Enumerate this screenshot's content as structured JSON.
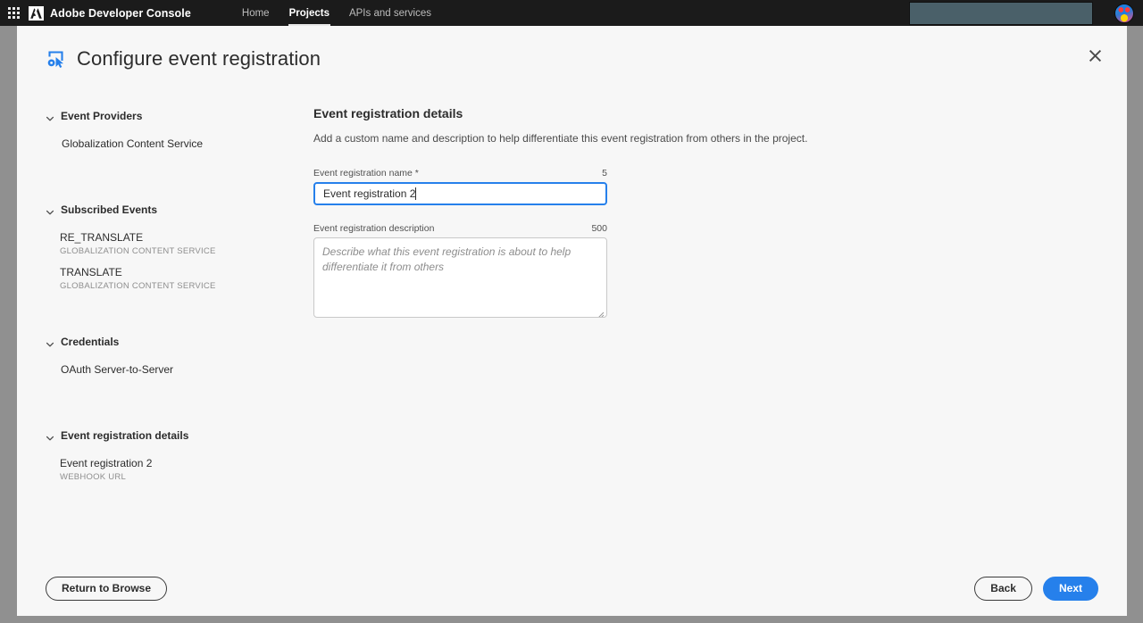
{
  "topbar": {
    "app_grid_icon": "app-grid-icon",
    "adobe_logo_icon": "adobe-logo-icon",
    "brand_name": "Adobe Developer Console",
    "nav": [
      {
        "label": "Home",
        "active": false
      },
      {
        "label": "Projects",
        "active": true
      },
      {
        "label": "APIs and services",
        "active": false
      }
    ],
    "avatar_icon": "user-avatar-icon"
  },
  "modal": {
    "title": "Configure event registration",
    "title_icon": "configure-event-icon",
    "close_icon": "close-icon"
  },
  "sidebar": {
    "groups": [
      {
        "title": "Event Providers",
        "chevron_icon": "chevron-down-icon",
        "items": [
          {
            "label": "Globalization Content Service",
            "sub": ""
          }
        ]
      },
      {
        "title": "Subscribed Events",
        "chevron_icon": "chevron-down-icon",
        "items": [
          {
            "label": "RE_TRANSLATE",
            "sub": "GLOBALIZATION CONTENT SERVICE"
          },
          {
            "label": "TRANSLATE",
            "sub": "GLOBALIZATION CONTENT SERVICE"
          }
        ]
      },
      {
        "title": "Credentials",
        "chevron_icon": "chevron-down-icon",
        "items": [
          {
            "label": "OAuth Server-to-Server",
            "sub": ""
          }
        ]
      },
      {
        "title": "Event registration details",
        "chevron_icon": "chevron-down-icon",
        "items": [
          {
            "label": "Event registration 2",
            "sub": "WEBHOOK URL"
          }
        ]
      }
    ]
  },
  "content": {
    "title": "Event registration details",
    "description": "Add a custom name and description to help differentiate this event registration from others in the project.",
    "name_field": {
      "label": "Event registration name *",
      "counter": "5",
      "value": "Event registration 2"
    },
    "description_field": {
      "label": "Event registration description",
      "counter": "500",
      "value": "",
      "placeholder": "Describe what this event registration is about to help differentiate it from others"
    }
  },
  "footer": {
    "return_label": "Return to Browse",
    "back_label": "Back",
    "next_label": "Next"
  },
  "colors": {
    "accent_blue": "#2680eb",
    "topbar_dark": "#1b1b1b",
    "backdrop_gray": "#909090",
    "panel_bg": "#f7f7f7"
  }
}
